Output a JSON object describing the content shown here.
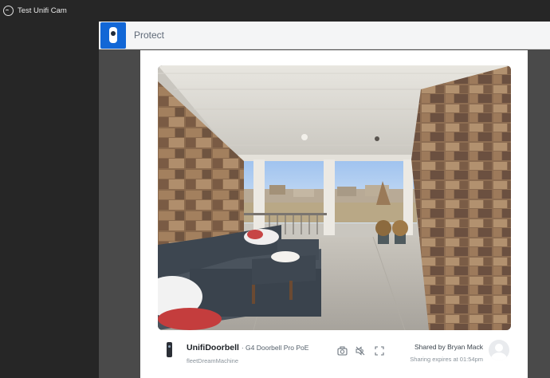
{
  "titlebar": {
    "app_title": "Test Unifi Cam"
  },
  "header": {
    "app_name": "Protect"
  },
  "camera": {
    "name": "UnifiDoorbell",
    "model": "G4 Doorbell Pro PoE",
    "host": "fleetDreamMachine"
  },
  "sharing": {
    "shared_by": "Shared by Bryan Mack",
    "expires": "Sharing expires at 01:54pm"
  },
  "actions": [
    {
      "icon": "camera-icon"
    },
    {
      "icon": "mute-icon"
    },
    {
      "icon": "fullscreen-icon"
    }
  ],
  "colors": {
    "brand": "#1267d6",
    "window_bg": "#4a4a4a",
    "app_bg": "#262626"
  }
}
